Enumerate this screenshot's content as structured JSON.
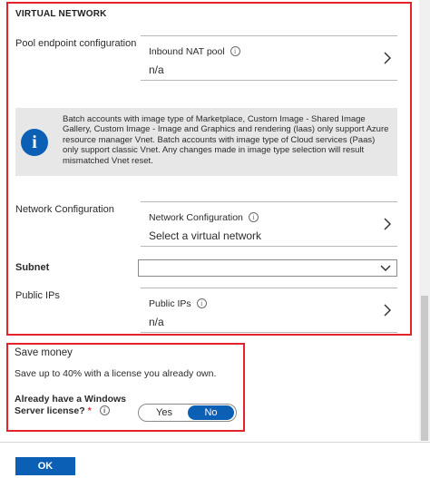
{
  "virtual_network": {
    "section_title": "VIRTUAL NETWORK",
    "pool_endpoint": {
      "row_label": "Pool endpoint configuration",
      "picker_title": "Inbound NAT pool",
      "picker_value": "n/a"
    },
    "info_message": "Batch accounts with image type of Marketplace, Custom Image - Shared Image Gallery, Custom Image - Image and Graphics and rendering (laas) only support Azure resource manager Vnet. Batch accounts with image type of Cloud services (Paas) only support classic Vnet. Any changes made in image type selection will result mismatched Vnet reset.",
    "network_configuration": {
      "row_label": "Network Configuration",
      "picker_title": "Network Configuration",
      "picker_value": "Select a virtual network"
    },
    "subnet": {
      "row_label": "Subnet",
      "selected_value": ""
    },
    "public_ips": {
      "row_label": "Public IPs",
      "picker_title": "Public IPs",
      "picker_value": "n/a"
    }
  },
  "save_money": {
    "title": "Save money",
    "description": "Save up to 40% with a license you already own.",
    "license_label": "Already have a Windows Server license?",
    "required_mark": "*",
    "toggle": {
      "yes_label": "Yes",
      "no_label": "No",
      "selected": "No"
    }
  },
  "footer": {
    "ok_label": "OK"
  },
  "icons": {
    "info_glyph": "i",
    "tooltip_glyph": "i"
  },
  "colors": {
    "highlight_border": "#e3242b",
    "accent": "#0b5fb4",
    "info_background": "#e7e7e7"
  }
}
